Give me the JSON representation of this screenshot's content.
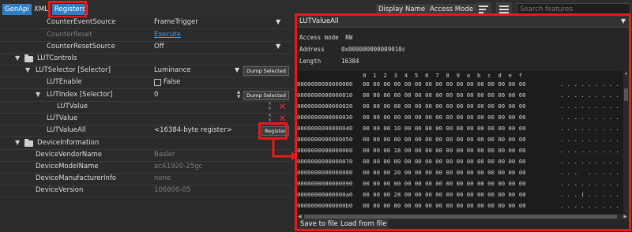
{
  "tabs": [
    {
      "label": "GenApi"
    },
    {
      "label": "XML"
    },
    {
      "label": "Registers"
    }
  ],
  "toolbar": {
    "display_name": "Display Name",
    "access_mode": "Access Mode",
    "search_placeholder": "Search features"
  },
  "tree": {
    "counter_event_source": {
      "name": "CounterEventSource",
      "value": "FrameTrigger"
    },
    "counter_reset": {
      "name": "CounterReset",
      "value": "Execute"
    },
    "counter_reset_source": {
      "name": "CounterResetSource",
      "value": "Off"
    },
    "lut_controls": {
      "name": "LUTControls"
    },
    "lut_selector": {
      "name": "LUTSelector [Selector]",
      "value": "Luminance",
      "button": "Dump Selected"
    },
    "lut_enable": {
      "name": "LUTEnable",
      "value": "False"
    },
    "lut_index": {
      "name": "LUTIndex [Selector]",
      "value": "0",
      "button": "Dump Selected"
    },
    "lut_value_child": {
      "name": "LUTValue"
    },
    "lut_value": {
      "name": "LUTValue"
    },
    "lut_value_all": {
      "name": "LUTValueAll",
      "value": "<16384-byte register>",
      "button": "Register"
    },
    "device_information": {
      "name": "DeviceInformation"
    },
    "device_vendor_name": {
      "name": "DeviceVendorName",
      "value": "Basler"
    },
    "device_model_name": {
      "name": "DeviceModelName",
      "value": "acA1920-25gc"
    },
    "device_manufacturer_info": {
      "name": "DeviceManufacturerInfo",
      "value": "none"
    },
    "device_version": {
      "name": "DeviceVersion",
      "value": "106800-05"
    }
  },
  "register_panel": {
    "title": "LUTValueAll",
    "access_mode_label": "Access mode",
    "access_mode_value": "RW",
    "address_label": "Address",
    "address_value": "0x000000000009010c",
    "length_label": "Length",
    "length_value": "16384",
    "hex_header": "0  1  2  3  4  5  6  7  8  9  a  b  c  d  e  f",
    "hex_rows": [
      {
        "addr": "0000000000000000",
        "bytes": "00 00 00 00 00 00 00 00 00 00 00 00 00 00 00 00",
        "ascii": ". . . . . . . . . . . . . . . ."
      },
      {
        "addr": "0000000000000010",
        "bytes": "00 00 00 00 00 00 00 00 00 00 00 00 00 00 00 00",
        "ascii": ". . . . . . . . . . . . . . . ."
      },
      {
        "addr": "0000000000000020",
        "bytes": "00 00 00 08 00 00 00 00 00 00 00 00 00 00 00 00",
        "ascii": ". . . . . . . . . . . . . . . ."
      },
      {
        "addr": "0000000000000030",
        "bytes": "00 00 00 00 00 00 00 00 00 00 00 00 00 00 00 00",
        "ascii": ". . . . . . . . . . . . . . . ."
      },
      {
        "addr": "0000000000000040",
        "bytes": "00 00 00 10 00 00 00 00 00 00 00 00 00 00 00 00",
        "ascii": ". . . . . . . . . . . . . . . ."
      },
      {
        "addr": "0000000000000050",
        "bytes": "00 00 00 00 00 00 00 00 00 00 00 00 00 00 00 00",
        "ascii": ". . . . . . . . . . . . . . . ."
      },
      {
        "addr": "0000000000000060",
        "bytes": "00 00 00 18 00 00 00 00 00 00 00 00 00 00 00 00",
        "ascii": ". . . . . . . . . . . . . . . ."
      },
      {
        "addr": "0000000000000070",
        "bytes": "00 00 00 00 00 00 00 00 00 00 00 00 00 00 00 00",
        "ascii": ". . . . . . . . . . . . . . . ."
      },
      {
        "addr": "0000000000000080",
        "bytes": "00 00 00 20 00 00 00 00 00 00 00 00 00 00 00 00",
        "ascii": ". . .   . . . . . . . . . . . ."
      },
      {
        "addr": "0000000000000090",
        "bytes": "00 00 00 00 00 00 00 00 00 00 00 00 00 00 00 00",
        "ascii": ". . . . . . . . . . . . . . . ."
      },
      {
        "addr": "00000000000000a0",
        "bytes": "00 00 00 28 00 00 00 00 00 00 00 00 00 00 00 00",
        "ascii": ". . . ( . . . . . . . . . . . ."
      },
      {
        "addr": "00000000000000b0",
        "bytes": "00 00 00 00 00 00 00 00 00 00 00 00 00 00 00 00",
        "ascii": ". . . . . . . . . . . . . . . ."
      }
    ],
    "save_label": "Save to file",
    "load_label": "Load from file"
  },
  "colors": {
    "highlight": "#e51a1a",
    "active_tab": "#2f7fc6",
    "link": "#3d9be9"
  }
}
